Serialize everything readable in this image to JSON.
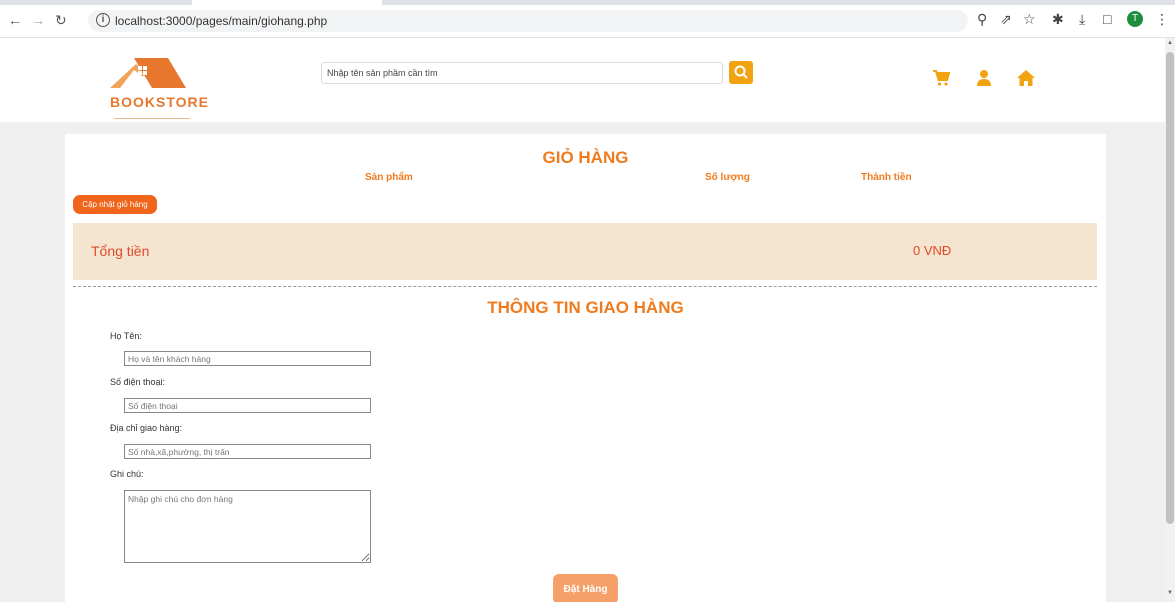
{
  "browser": {
    "url": "localhost:3000/pages/main/giohang.php",
    "profile_initial": "T"
  },
  "header": {
    "logo_text": "BOOKSTORE",
    "search_placeholder": "Nhập tên sản phầm cần tìm",
    "icons": [
      "search-icon",
      "cart-icon",
      "user-icon",
      "home-icon"
    ],
    "accent_color": "#f2a311"
  },
  "cart": {
    "title": "GIỎ HÀNG",
    "columns": [
      "Sản phẩm",
      "Số lượng",
      "Thành tiền"
    ],
    "update_button": "Cập nhật giỏ hàng",
    "total_label": "Tổng tiền",
    "total_value": "0 VNĐ"
  },
  "shipping": {
    "title": "THÔNG TIN GIAO HÀNG",
    "name_label": "Họ Tên:",
    "name_placeholder": "Họ và tên khách hàng",
    "phone_label": "Số điện thoại:",
    "phone_placeholder": "Số điện thoại",
    "address_label": "Địa chỉ giao hàng:",
    "address_placeholder": "Số nhà,xã,phường, thị trấn",
    "note_label": "Ghi chú:",
    "note_placeholder": "Nhập ghi chú cho đơn hàng",
    "submit_button": "Đặt Hàng"
  },
  "colors": {
    "brand_orange": "#f07b1d",
    "total_bg": "#f5e4cf",
    "total_text": "#e04a2a"
  }
}
